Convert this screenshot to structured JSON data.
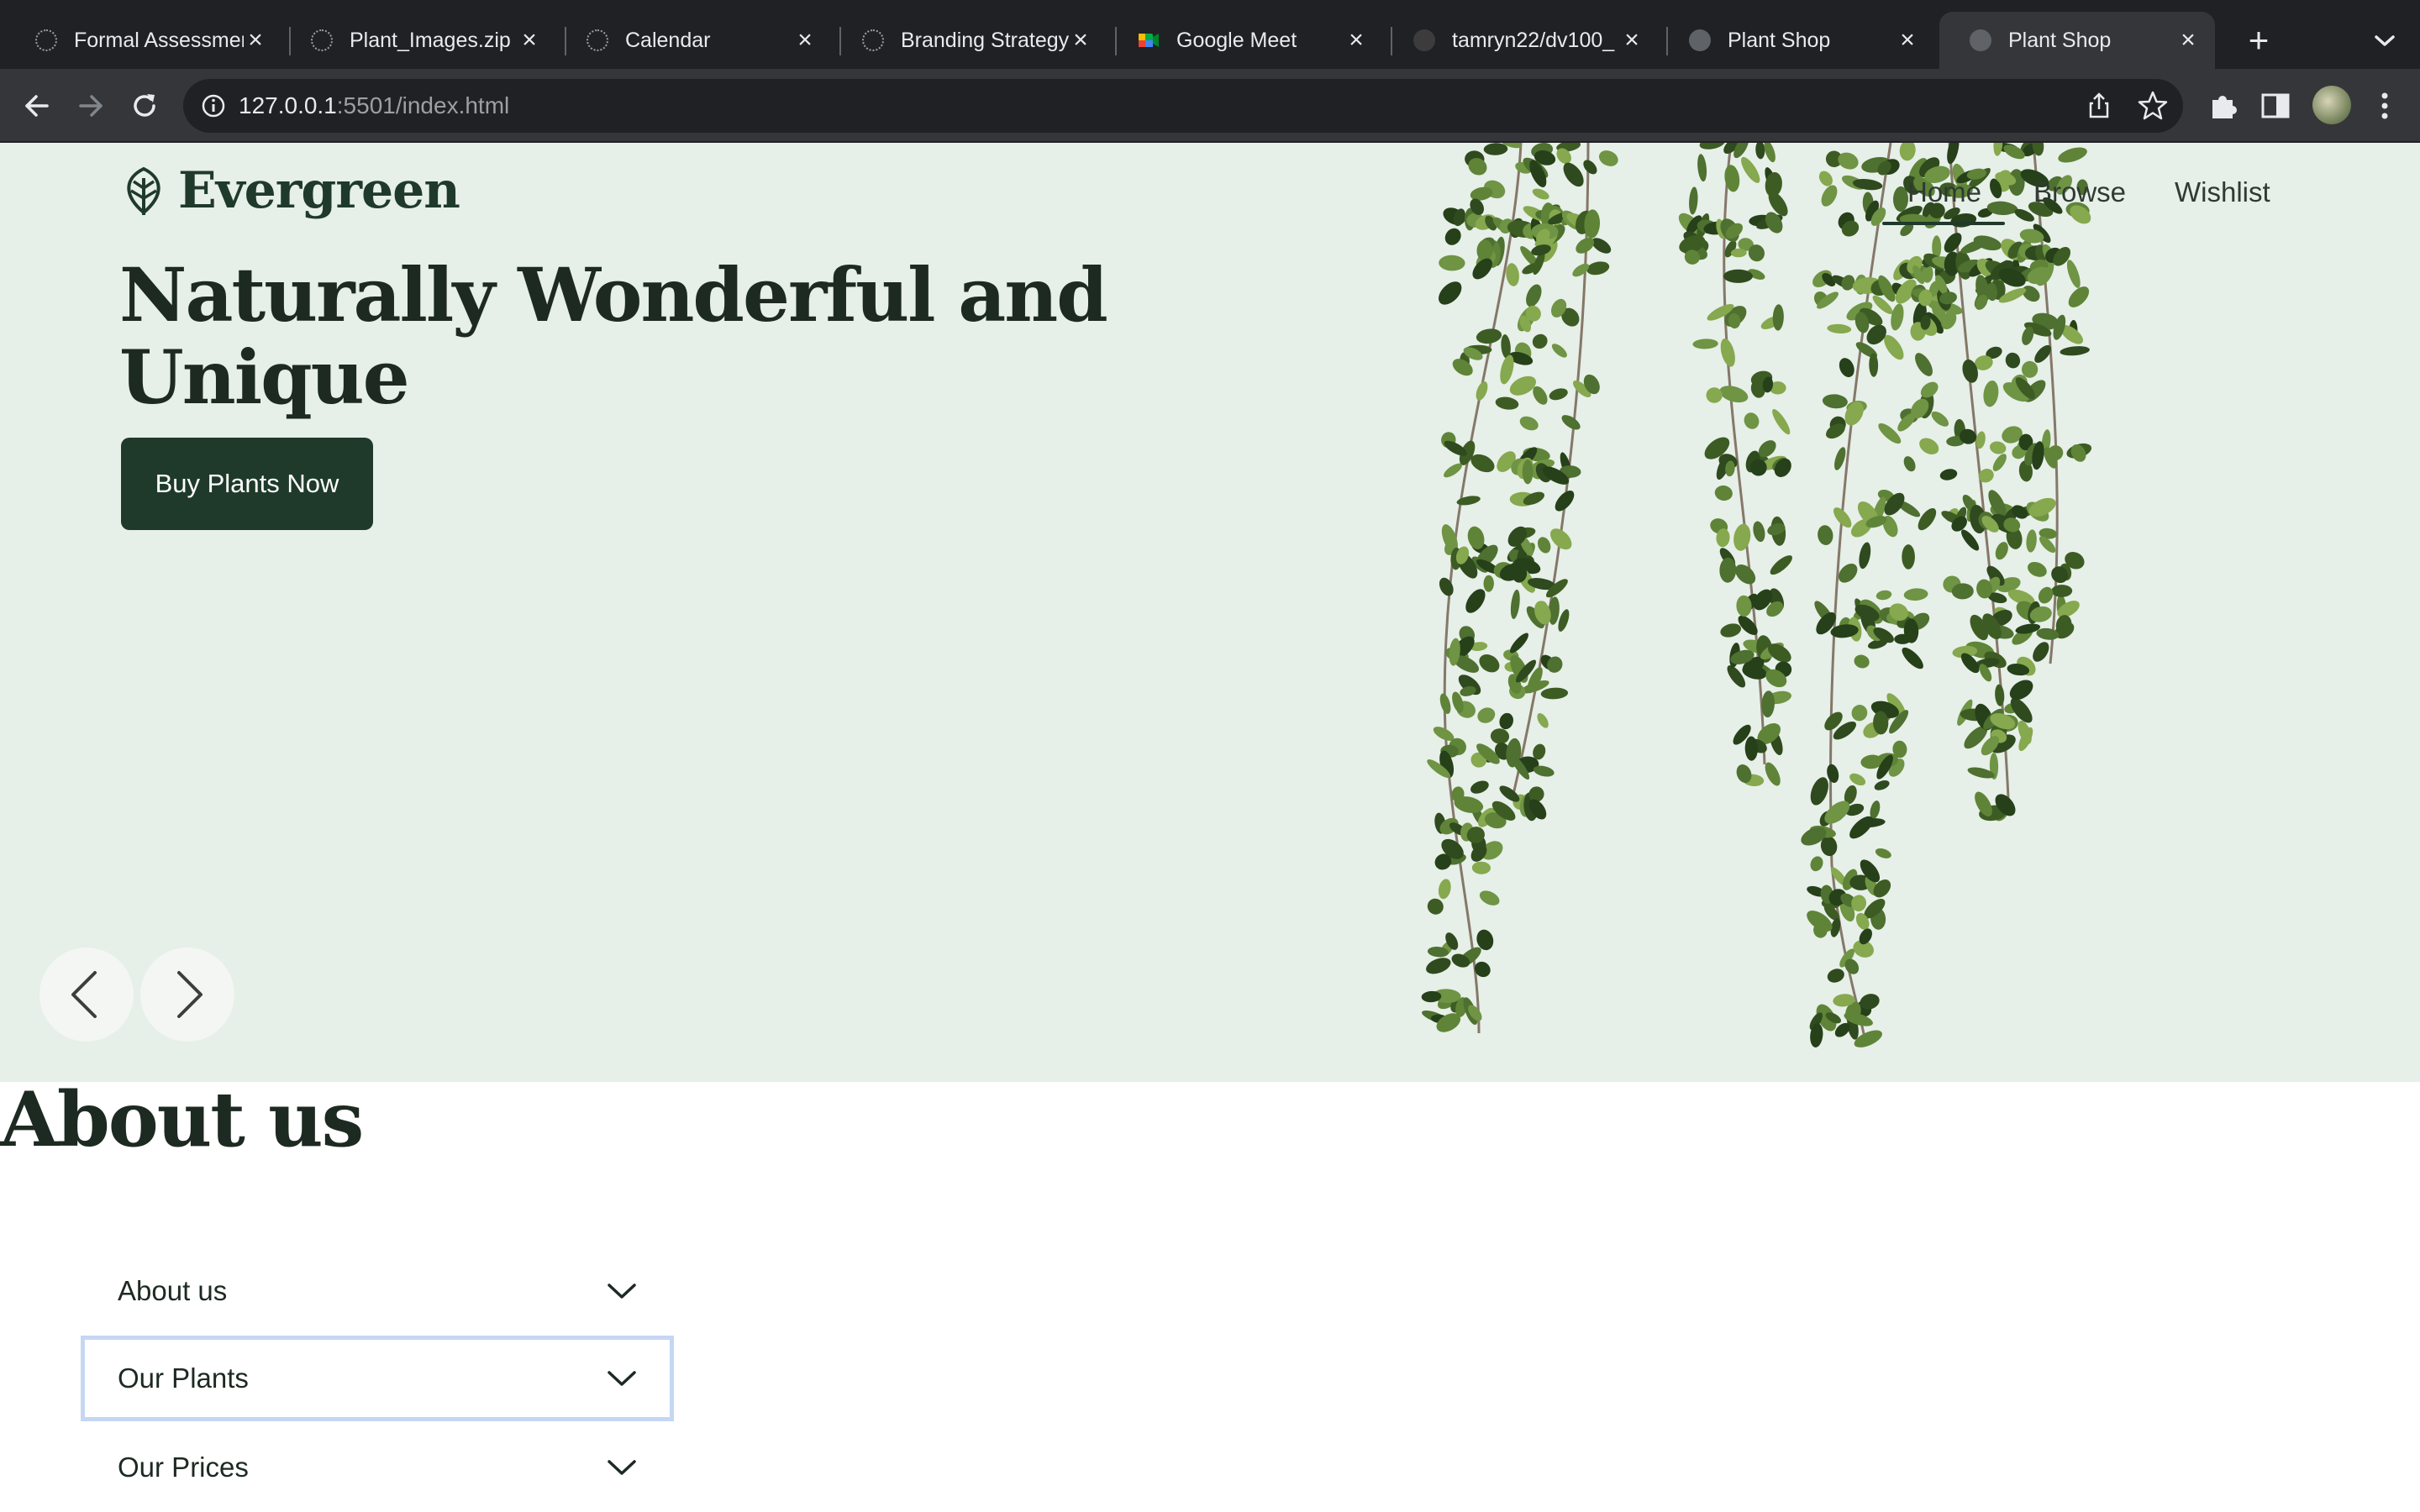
{
  "browser": {
    "tabs": [
      {
        "title": "Formal Assessment",
        "icon": "loading-spinner-icon"
      },
      {
        "title": "Plant_Images.zip",
        "icon": "loading-spinner-icon"
      },
      {
        "title": "Calendar",
        "icon": "loading-spinner-icon"
      },
      {
        "title": "Branding Strategy",
        "icon": "loading-spinner-icon"
      },
      {
        "title": "Google Meet",
        "icon": "google-meet-icon"
      },
      {
        "title": "tamryn22/dv100_",
        "icon": "github-icon"
      },
      {
        "title": "Plant Shop",
        "icon": "globe-icon"
      },
      {
        "title": "Plant Shop",
        "icon": "globe-icon",
        "active": true
      }
    ],
    "url_host": "127.0.0.1",
    "url_rest": ":5501/index.html"
  },
  "site": {
    "brand": "Evergreen",
    "nav": {
      "home": "Home",
      "browse": "Browse",
      "wishlist": "Wishlist",
      "active": "home"
    },
    "hero": {
      "title": "Naturally Wonderful and Unique",
      "cta": "Buy Plants Now"
    },
    "about": {
      "heading": "About us",
      "accordion": [
        {
          "label": "About us",
          "focused": false
        },
        {
          "label": "Our Plants",
          "focused": true
        },
        {
          "label": "Our Prices",
          "focused": false
        }
      ]
    }
  },
  "colors": {
    "brand_green": "#1f3a2b",
    "hero_bg": "#e6efe8",
    "focus_ring": "#c6d6f3",
    "chrome_dark": "#202124",
    "chrome_toolbar": "#35363a"
  }
}
